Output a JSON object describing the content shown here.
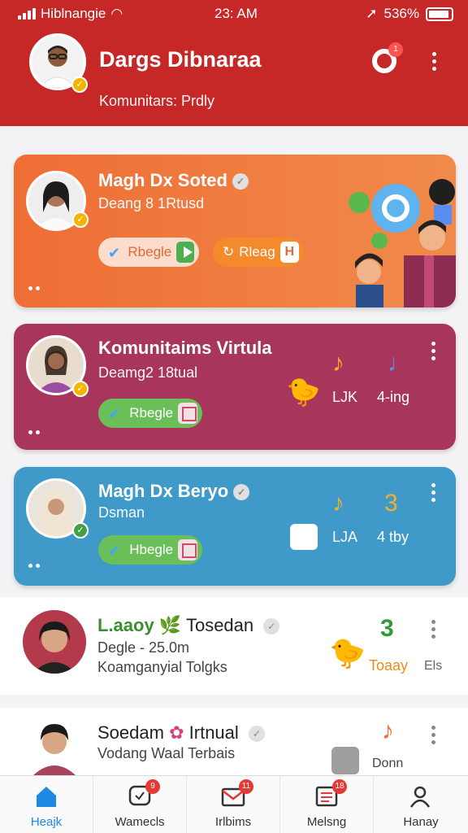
{
  "status": {
    "carrier": "Hiblnangie",
    "time": "23: AM",
    "battery": "536%"
  },
  "header": {
    "title": "Dargs Dibnaraa",
    "subtitle": "Komunitars: Prdly",
    "notification_count": "1"
  },
  "cards": [
    {
      "title": "Magh Dx Soted",
      "subtitle": "Deang 8 1Rtusd",
      "buttons": [
        "Rbegle",
        "Rleag"
      ],
      "button_box": "H",
      "color": "#ef6e35"
    },
    {
      "title": "Komunitaims Virtula",
      "subtitle": "Deamg2 18tual",
      "buttons": [
        "Rbegle"
      ],
      "labels": [
        "LJK",
        "4-ing"
      ],
      "color": "#a8355b"
    },
    {
      "title": "Magh Dx Beryo",
      "subtitle": "Dsman",
      "buttons": [
        "Hbegle"
      ],
      "labels": [
        "LJA",
        "4 tby"
      ],
      "note_3": "3",
      "color": "#3f99c9"
    }
  ],
  "list": [
    {
      "title_prefix": "L.aaoy",
      "title": "Tosedan",
      "line1": "Degle - 25.0m",
      "line2": "Koamganyial Tolgks",
      "right_label": "Toaay",
      "right_label2": "Els",
      "note": "3"
    },
    {
      "title": "Soedam",
      "title_suffix": "Irtnual",
      "line1": "Vodang Waal Terbais",
      "right_label": "Donn"
    }
  ],
  "nav": [
    {
      "label": "Heajk",
      "icon": "home-icon"
    },
    {
      "label": "Wamecls",
      "icon": "chat-icon",
      "badge": "9"
    },
    {
      "label": "Irlbims",
      "icon": "mail-icon",
      "badge": "11"
    },
    {
      "label": "Melsng",
      "icon": "inbox-icon",
      "badge": "18"
    },
    {
      "label": "Hanay",
      "icon": "profile-icon"
    }
  ]
}
